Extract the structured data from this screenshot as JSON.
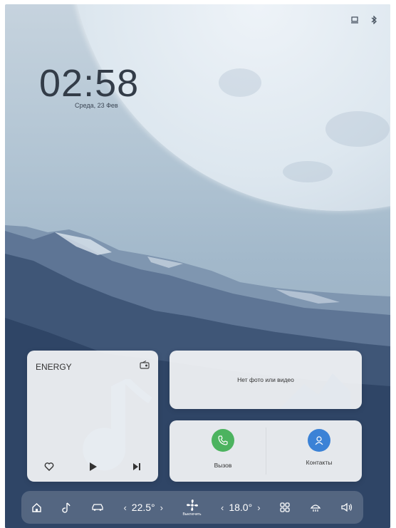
{
  "status_bar": {
    "icons": [
      "profile-icon",
      "bluetooth-icon"
    ]
  },
  "clock": {
    "time": "02:58",
    "date": "Среда,  23 Фев"
  },
  "music_widget": {
    "station": "ENERGY",
    "icons": [
      "radio-icon",
      "heart-icon",
      "play-icon",
      "next-icon",
      "music-note-icon"
    ]
  },
  "photo_widget": {
    "message": "Нет фото или видео"
  },
  "quick_actions": {
    "call": {
      "label": "Вызов",
      "color": "#4cb35f"
    },
    "contacts": {
      "label": "Контакты",
      "color": "#3b82d6"
    }
  },
  "dock": {
    "driver_temp": "22.5°",
    "passenger_temp": "18.0°",
    "fan_label": "Выключить",
    "icons": [
      "home-icon",
      "music-icon",
      "car-icon",
      "fan-icon",
      "apps-icon",
      "defrost-icon",
      "volume-icon"
    ]
  }
}
